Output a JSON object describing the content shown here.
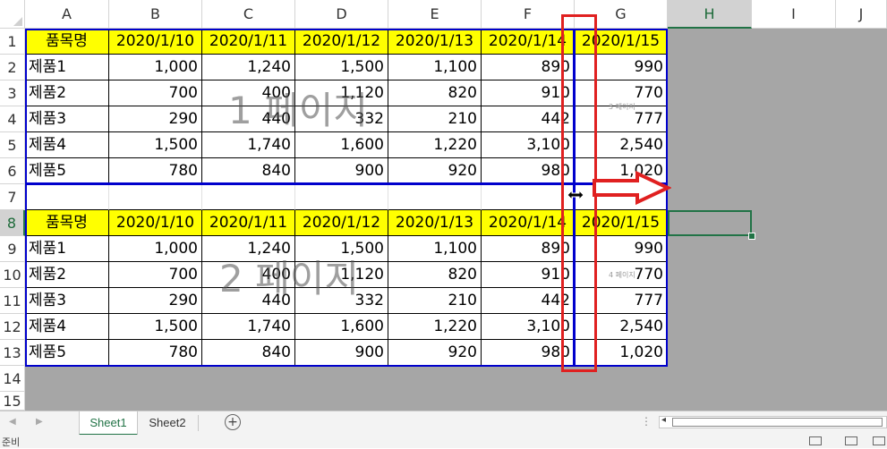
{
  "columns": [
    "A",
    "B",
    "C",
    "D",
    "E",
    "F",
    "G",
    "H",
    "I",
    "J"
  ],
  "rows": [
    "1",
    "2",
    "3",
    "4",
    "5",
    "6",
    "7",
    "8",
    "9",
    "10",
    "11",
    "12",
    "13",
    "14",
    "15"
  ],
  "table1": {
    "header": [
      "품목명",
      "2020/1/10",
      "2020/1/11",
      "2020/1/12",
      "2020/1/13",
      "2020/1/14",
      "2020/1/15"
    ],
    "data": [
      [
        "제품1",
        "1,000",
        "1,240",
        "1,500",
        "1,100",
        "890",
        "990"
      ],
      [
        "제품2",
        "700",
        "400",
        "1,120",
        "820",
        "910",
        "770"
      ],
      [
        "제품3",
        "290",
        "440",
        "332",
        "210",
        "442",
        "777"
      ],
      [
        "제품4",
        "1,500",
        "1,740",
        "1,600",
        "1,220",
        "3,100",
        "2,540"
      ],
      [
        "제품5",
        "780",
        "840",
        "900",
        "920",
        "980",
        "1,020"
      ]
    ]
  },
  "table2": {
    "header": [
      "품목명",
      "2020/1/10",
      "2020/1/11",
      "2020/1/12",
      "2020/1/13",
      "2020/1/14",
      "2020/1/15"
    ],
    "data": [
      [
        "제품1",
        "1,000",
        "1,240",
        "1,500",
        "1,100",
        "890",
        "990"
      ],
      [
        "제품2",
        "700",
        "400",
        "1,120",
        "820",
        "910",
        "770"
      ],
      [
        "제품3",
        "290",
        "440",
        "332",
        "210",
        "442",
        "777"
      ],
      [
        "제품4",
        "1,500",
        "1,740",
        "1,600",
        "1,220",
        "3,100",
        "2,540"
      ],
      [
        "제품5",
        "780",
        "840",
        "900",
        "920",
        "980",
        "1,020"
      ]
    ]
  },
  "watermarks": {
    "page1": "1 페이지",
    "page2": "2 페이지",
    "page3": "3 페이지",
    "page4": "4 페이지"
  },
  "sheets": [
    "Sheet1",
    "Sheet2"
  ],
  "active_sheet": "Sheet1",
  "status_text": "준비",
  "selected_cell": "H8",
  "colors": {
    "header_fill": "#ffff00",
    "page_break": "#0000cc",
    "annotation": "#e02020",
    "excel_green": "#217346"
  },
  "icons": [
    "scroll-left-icon",
    "scroll-right-icon",
    "add-sheet-icon",
    "resize-cursor-icon",
    "red-arrow-icon",
    "sheet-options-icon",
    "normal-view-icon",
    "page-layout-icon"
  ]
}
